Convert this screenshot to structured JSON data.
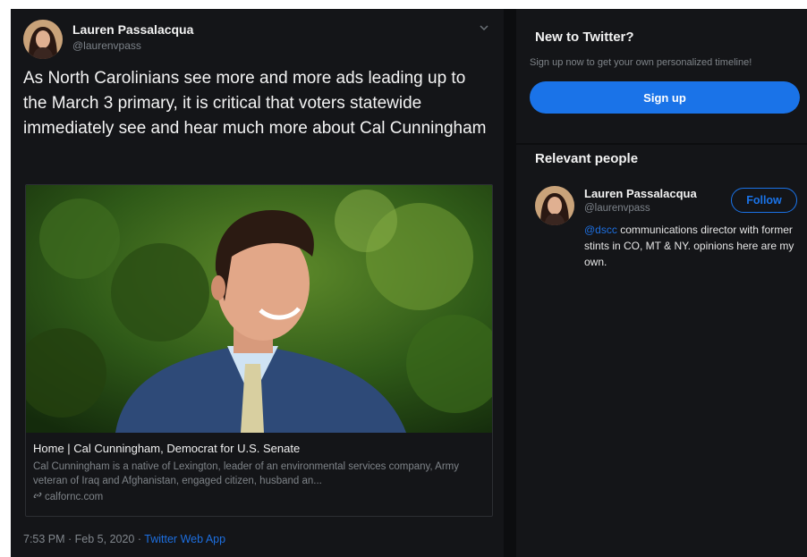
{
  "tweet": {
    "author_name": "Lauren Passalacqua",
    "author_handle": "@laurenvpass",
    "caret_icon": "chevron-down-icon",
    "text": "As North Carolinians see more and more ads leading up to the March 3 primary, it is critical that voters statewide immediately see and hear much more about Cal Cunningham",
    "card": {
      "title": "Home | Cal Cunningham, Democrat for U.S. Senate",
      "description": "Cal Cunningham is a native of Lexington, leader of an environmental services company, Army veteran of Iraq and Afghanistan, engaged citizen, husband an...",
      "url": "calfornc.com",
      "link_icon": "link-icon"
    },
    "timestamp": "7:53 PM · Feb 5, 2020",
    "separator": " · ",
    "source": "Twitter Web App"
  },
  "sidebar": {
    "new_to_twitter": {
      "title": "New to Twitter?",
      "subtitle": "Sign up now to get your own personalized timeline!",
      "signup_label": "Sign up"
    },
    "relevant_people": {
      "title": "Relevant people",
      "person": {
        "name": "Lauren Passalacqua",
        "handle": "@laurenvpass",
        "follow_label": "Follow",
        "bio_mention": "@dscc",
        "bio_text": " communications director with former stints in CO, MT & NY. opinions here are my own."
      }
    }
  },
  "colors": {
    "background": "#141518",
    "accent": "#1a73e8",
    "muted_text": "#7f8489"
  }
}
